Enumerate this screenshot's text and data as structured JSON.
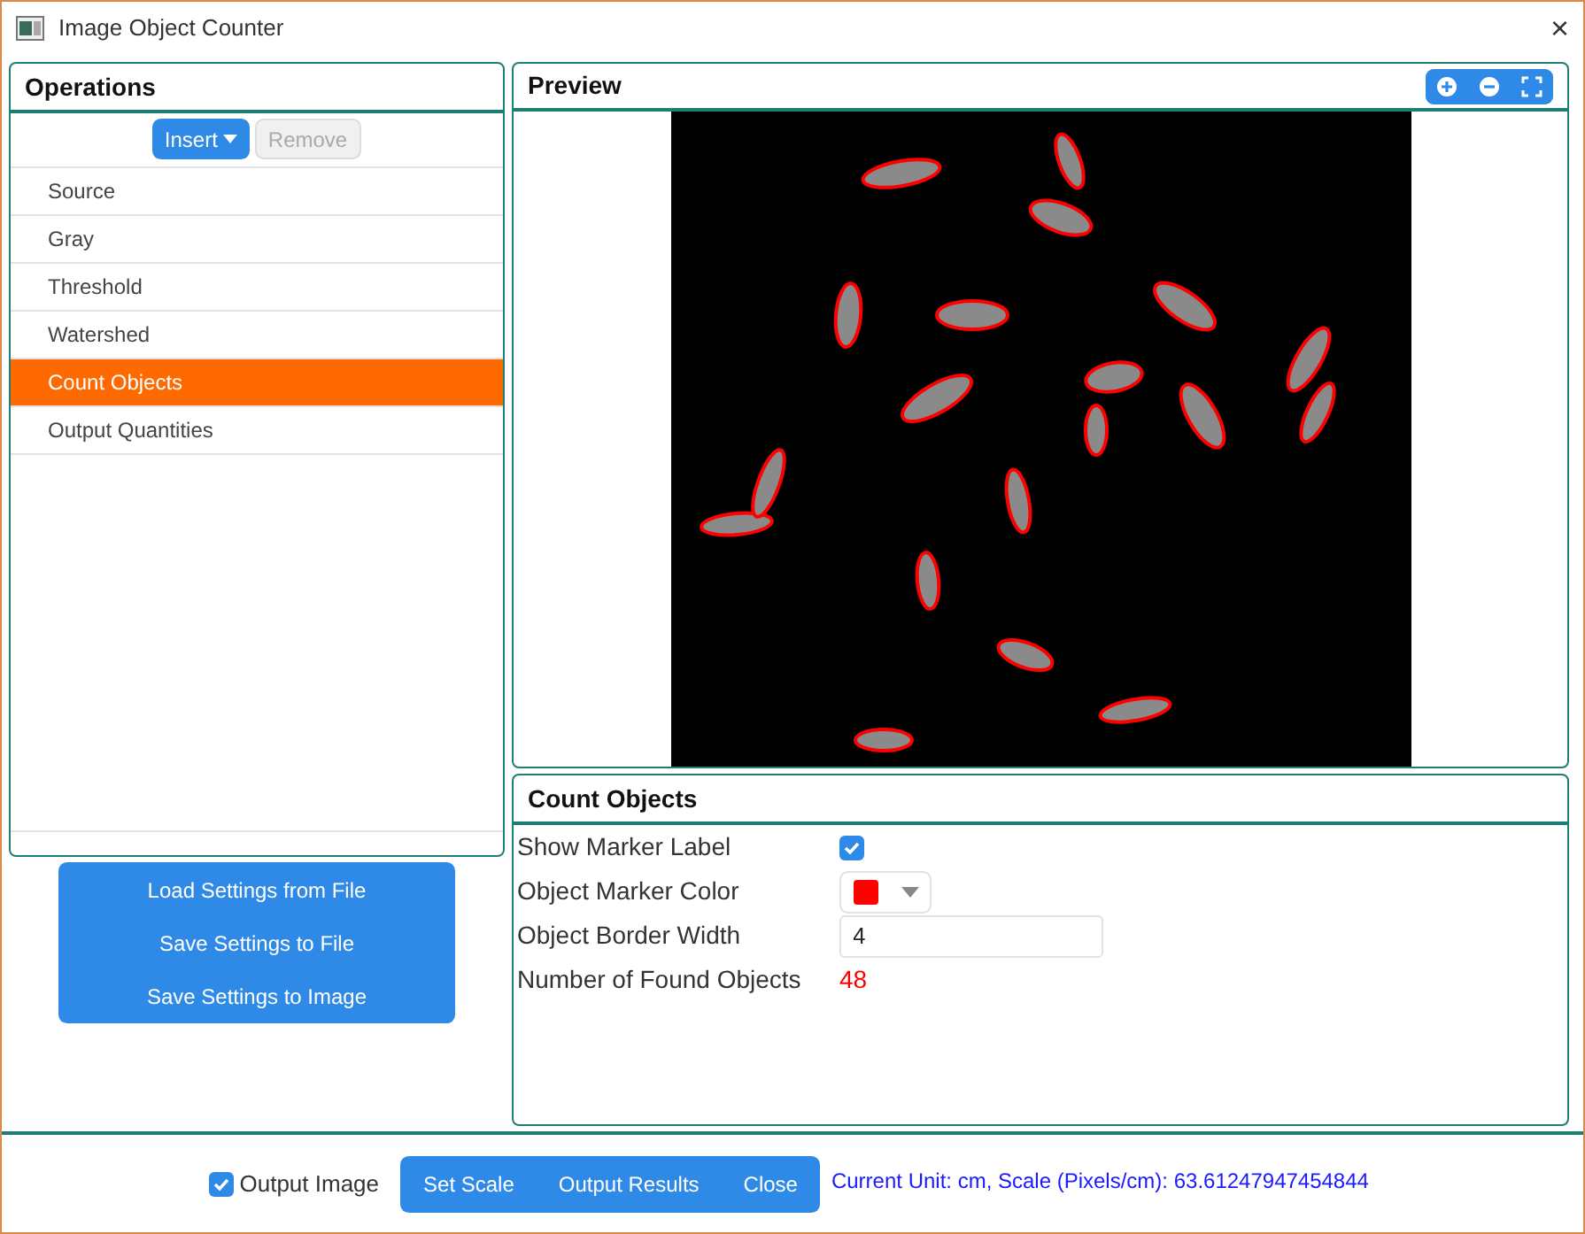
{
  "window": {
    "title": "Image Object Counter",
    "close": "×"
  },
  "operations": {
    "title": "Operations",
    "insert_button": "Insert",
    "remove_button": {
      "label": "Remove",
      "disabled": true
    },
    "items": [
      {
        "label": "Source",
        "selected": false
      },
      {
        "label": "Gray",
        "selected": false
      },
      {
        "label": "Threshold",
        "selected": false
      },
      {
        "label": "Watershed",
        "selected": false
      },
      {
        "label": "Count Objects",
        "selected": true
      },
      {
        "label": "Output Quantities",
        "selected": false
      }
    ]
  },
  "settings_buttons": [
    "Load Settings from File",
    "Save Settings to File",
    "Save Settings to Image"
  ],
  "preview": {
    "title": "Preview"
  },
  "properties": {
    "title": "Count Objects",
    "show_marker_label": {
      "label": "Show Marker Label",
      "checked": true
    },
    "marker_color": {
      "label": "Object Marker Color",
      "color": "#ff0000"
    },
    "border_width": {
      "label": "Object Border Width",
      "value": "4"
    },
    "found_objects": {
      "label": "Number of Found Objects",
      "value": "48"
    }
  },
  "footer": {
    "output_image": {
      "label": "Output Image",
      "checked": true
    },
    "buttons": [
      "Set Scale",
      "Output Results",
      "Close"
    ],
    "status": "Current Unit: cm, Scale (Pixels/cm): 63.61247947454844"
  }
}
